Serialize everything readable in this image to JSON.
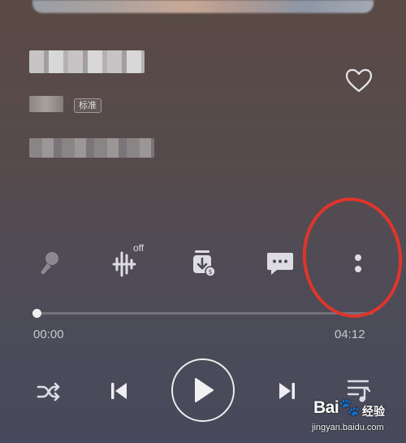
{
  "player": {
    "quality_badge": "标准",
    "effect_superscript": "off",
    "current_time": "00:00",
    "total_time": "04:12",
    "progress": 0.0
  },
  "actions": [
    {
      "name": "sing-icon",
      "label": "sing"
    },
    {
      "name": "sound-effect-icon",
      "label": "sound effect"
    },
    {
      "name": "download-icon",
      "label": "download"
    },
    {
      "name": "comment-icon",
      "label": "comments"
    },
    {
      "name": "more-icon",
      "label": "more"
    }
  ],
  "controls": [
    "shuffle-icon",
    "previous-icon",
    "play-icon",
    "next-icon",
    "playlist-icon"
  ],
  "watermark": {
    "brand": "Bai🐾",
    "text": "经验",
    "url": "jingyan.baidu.com"
  },
  "colors": {
    "annotation": "#e0352b",
    "icon": "#dcdce2"
  }
}
